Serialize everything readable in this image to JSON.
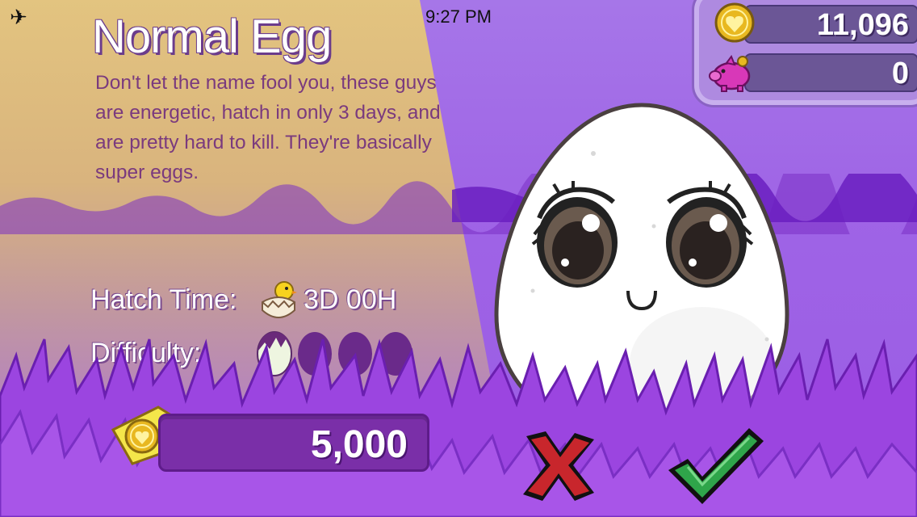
{
  "status_bar": {
    "time": "9:27 PM",
    "airplane_icon": "airplane-icon",
    "battery_icon": "battery-icon"
  },
  "egg": {
    "name": "Normal Egg",
    "description": "Don't let the name fool you, these guys are energetic, hatch in only 3 days, and are pretty hard to kill. They're basically super eggs.",
    "hatch_time_label": "Hatch Time:",
    "hatch_time_value": "3D 00H",
    "difficulty_label": "Difficulty:",
    "difficulty": {
      "level": 1,
      "max": 4
    }
  },
  "price": {
    "value": "5,000",
    "icon": "coin-price-tag-icon"
  },
  "currency": {
    "coins": "11,096",
    "piggy_bank": "0"
  },
  "buttons": {
    "cancel_icon": "red-x-icon",
    "confirm_icon": "green-check-icon"
  },
  "colors": {
    "background": "#9a5fe0",
    "spotlight": "#e6c87a",
    "price_bar": "#7a2fa8",
    "description_text": "#7a3a7e",
    "cancel": "#c8262c",
    "confirm": "#2fa54a"
  }
}
